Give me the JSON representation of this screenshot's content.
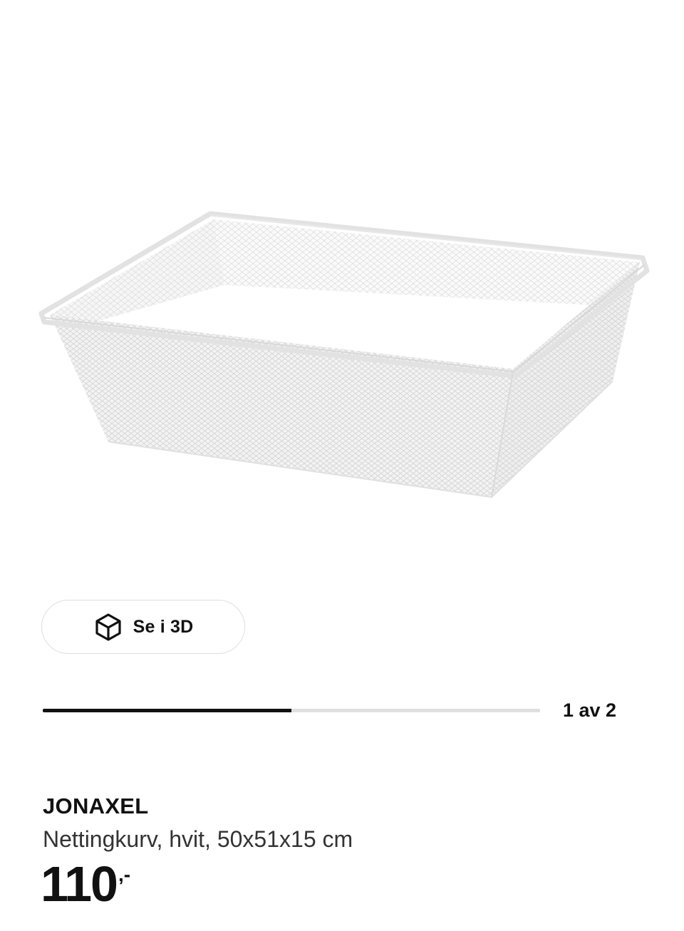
{
  "product": {
    "image_icon": "wire-mesh-basket",
    "view_3d": {
      "icon": "cube-icon",
      "label": "Se i 3D"
    },
    "gallery": {
      "current": 1,
      "total": 2,
      "progress_fraction": 0.5,
      "counter_text": "1 av 2"
    },
    "name": "JONAXEL",
    "description": "Nettingkurv, hvit, 50x51x15 cm",
    "price": {
      "amount": "110",
      "suffix": ",-"
    }
  },
  "colors": {
    "text": "#111111",
    "track": "#dfdfdf",
    "border": "#dfdfdf"
  }
}
